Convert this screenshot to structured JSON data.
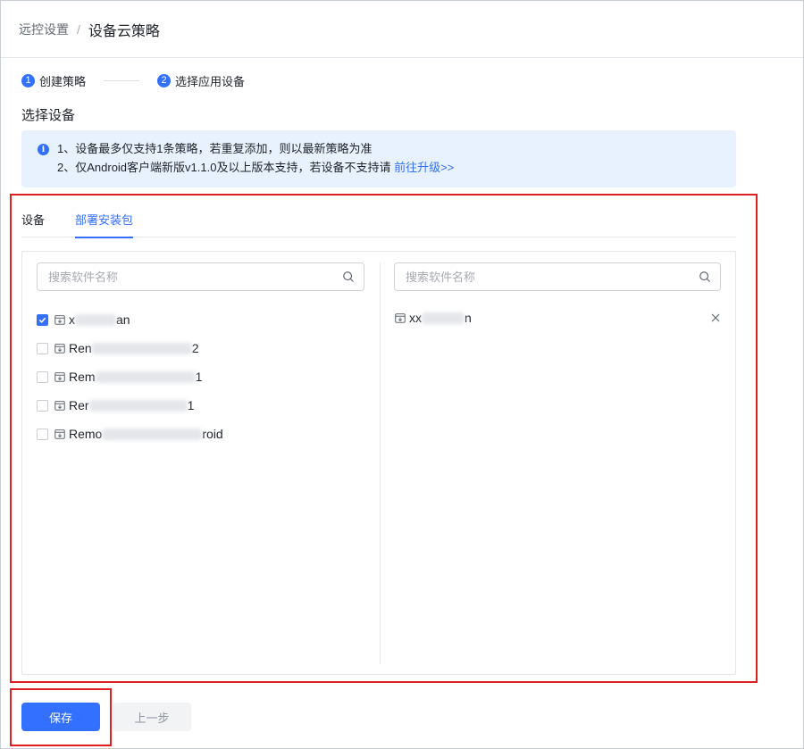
{
  "breadcrumb": {
    "parent": "远控设置",
    "separator": "/",
    "current": "设备云策略"
  },
  "steps": [
    {
      "number": "1",
      "label": "创建策略"
    },
    {
      "number": "2",
      "label": "选择应用设备"
    }
  ],
  "section_title": "选择设备",
  "alert": {
    "icon_text": "i",
    "line1": "1、设备最多仅支持1条策略，若重复添加，则以最新策略为准",
    "line2_prefix": "2、仅Android客户端新版v1.1.0及以上版本支持，若设备不支持请 ",
    "line2_link": "前往升级>>"
  },
  "tabs": [
    {
      "label": "设备",
      "active": false
    },
    {
      "label": "部署安装包",
      "active": true
    }
  ],
  "transfer": {
    "left_search_placeholder": "搜索软件名称",
    "right_search_placeholder": "搜索软件名称",
    "left_items": [
      {
        "prefix": "x",
        "suffix": "an",
        "checked": true
      },
      {
        "prefix": "Ren",
        "suffix": "2",
        "checked": false
      },
      {
        "prefix": "Rem",
        "suffix": "1",
        "checked": false
      },
      {
        "prefix": "Rer",
        "suffix": "1",
        "checked": false
      },
      {
        "prefix": "Remo",
        "suffix": "roid",
        "checked": false
      }
    ],
    "right_items": [
      {
        "prefix": "xx",
        "suffix": "n"
      }
    ]
  },
  "buttons": {
    "save": "保存",
    "prev": "上一步"
  },
  "colors": {
    "primary": "#3370ff",
    "highlight": "#e02020",
    "alert_bg": "#e8f2fe"
  }
}
